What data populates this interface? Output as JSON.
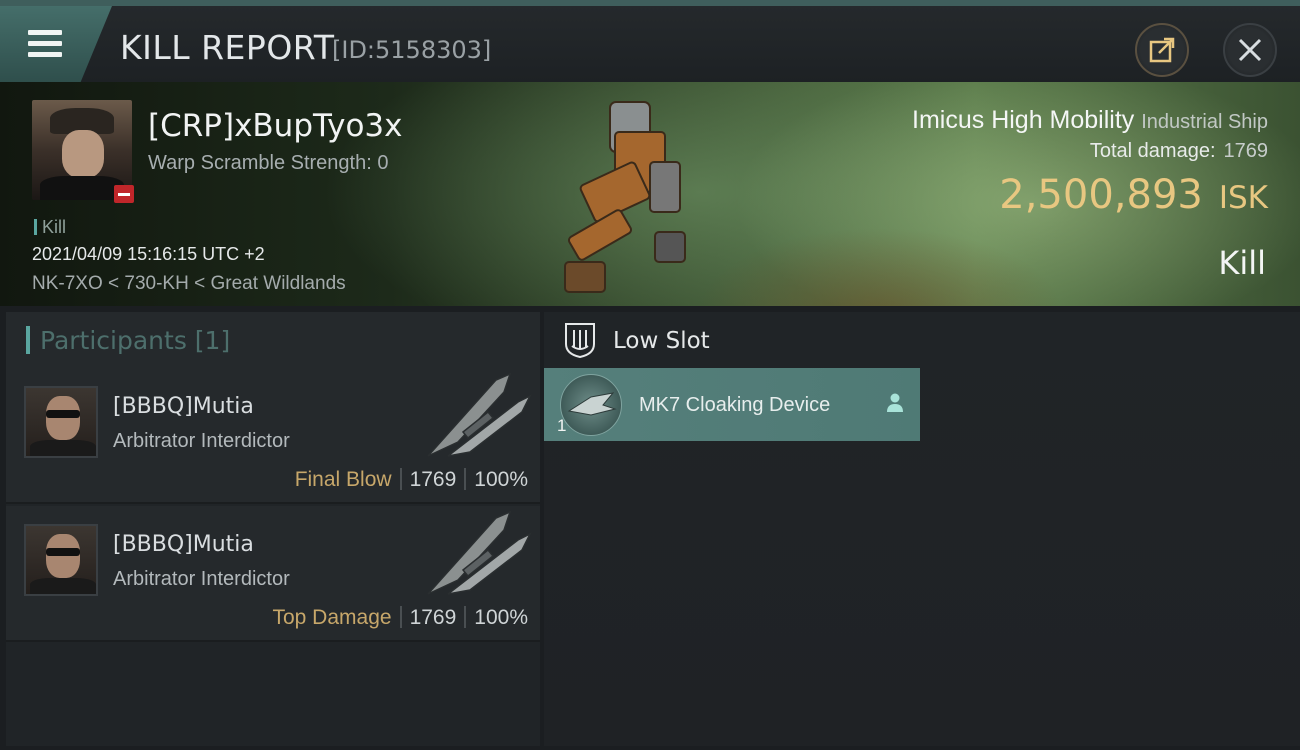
{
  "header": {
    "title": "KILL REPORT",
    "id_text": "[ID:5158303]",
    "menu_icon": "hamburger-menu-icon",
    "share_icon": "external-link-icon",
    "close_icon": "close-icon"
  },
  "victim": {
    "name": "[CRP]xBupTyo3x",
    "warp_scramble": "Warp Scramble Strength: 0",
    "kill_tag": "Kill",
    "timestamp": "2021/04/09 15:16:15 UTC +2",
    "location": "NK-7XO < 730-KH < Great Wildlands"
  },
  "ship": {
    "name": "Imicus High Mobility",
    "class": "Industrial Ship",
    "total_damage_label": "Total damage:",
    "total_damage_value": "1769",
    "isk_value": "2,500,893",
    "isk_unit": "ISK",
    "result": "Kill"
  },
  "participants": {
    "title": "Participants [1]",
    "items": [
      {
        "name": "[BBBQ]Mutia",
        "ship": "Arbitrator Interdictor",
        "role": "Final Blow",
        "damage": "1769",
        "percent": "100%"
      },
      {
        "name": "[BBBQ]Mutia",
        "ship": "Arbitrator Interdictor",
        "role": "Top Damage",
        "damage": "1769",
        "percent": "100%"
      }
    ]
  },
  "fitting": {
    "slot_title": "Low Slot",
    "slot_icon": "low-slot-icon",
    "modules": [
      {
        "quantity": "1",
        "name": "MK7 Cloaking Device",
        "status_icon": "person-icon"
      }
    ]
  },
  "colors": {
    "accent": "#5aa6a0",
    "isk": "#e8c781",
    "role": "#c7a76a",
    "module_bg": "#557f7b",
    "badge_red": "#c0262a"
  }
}
